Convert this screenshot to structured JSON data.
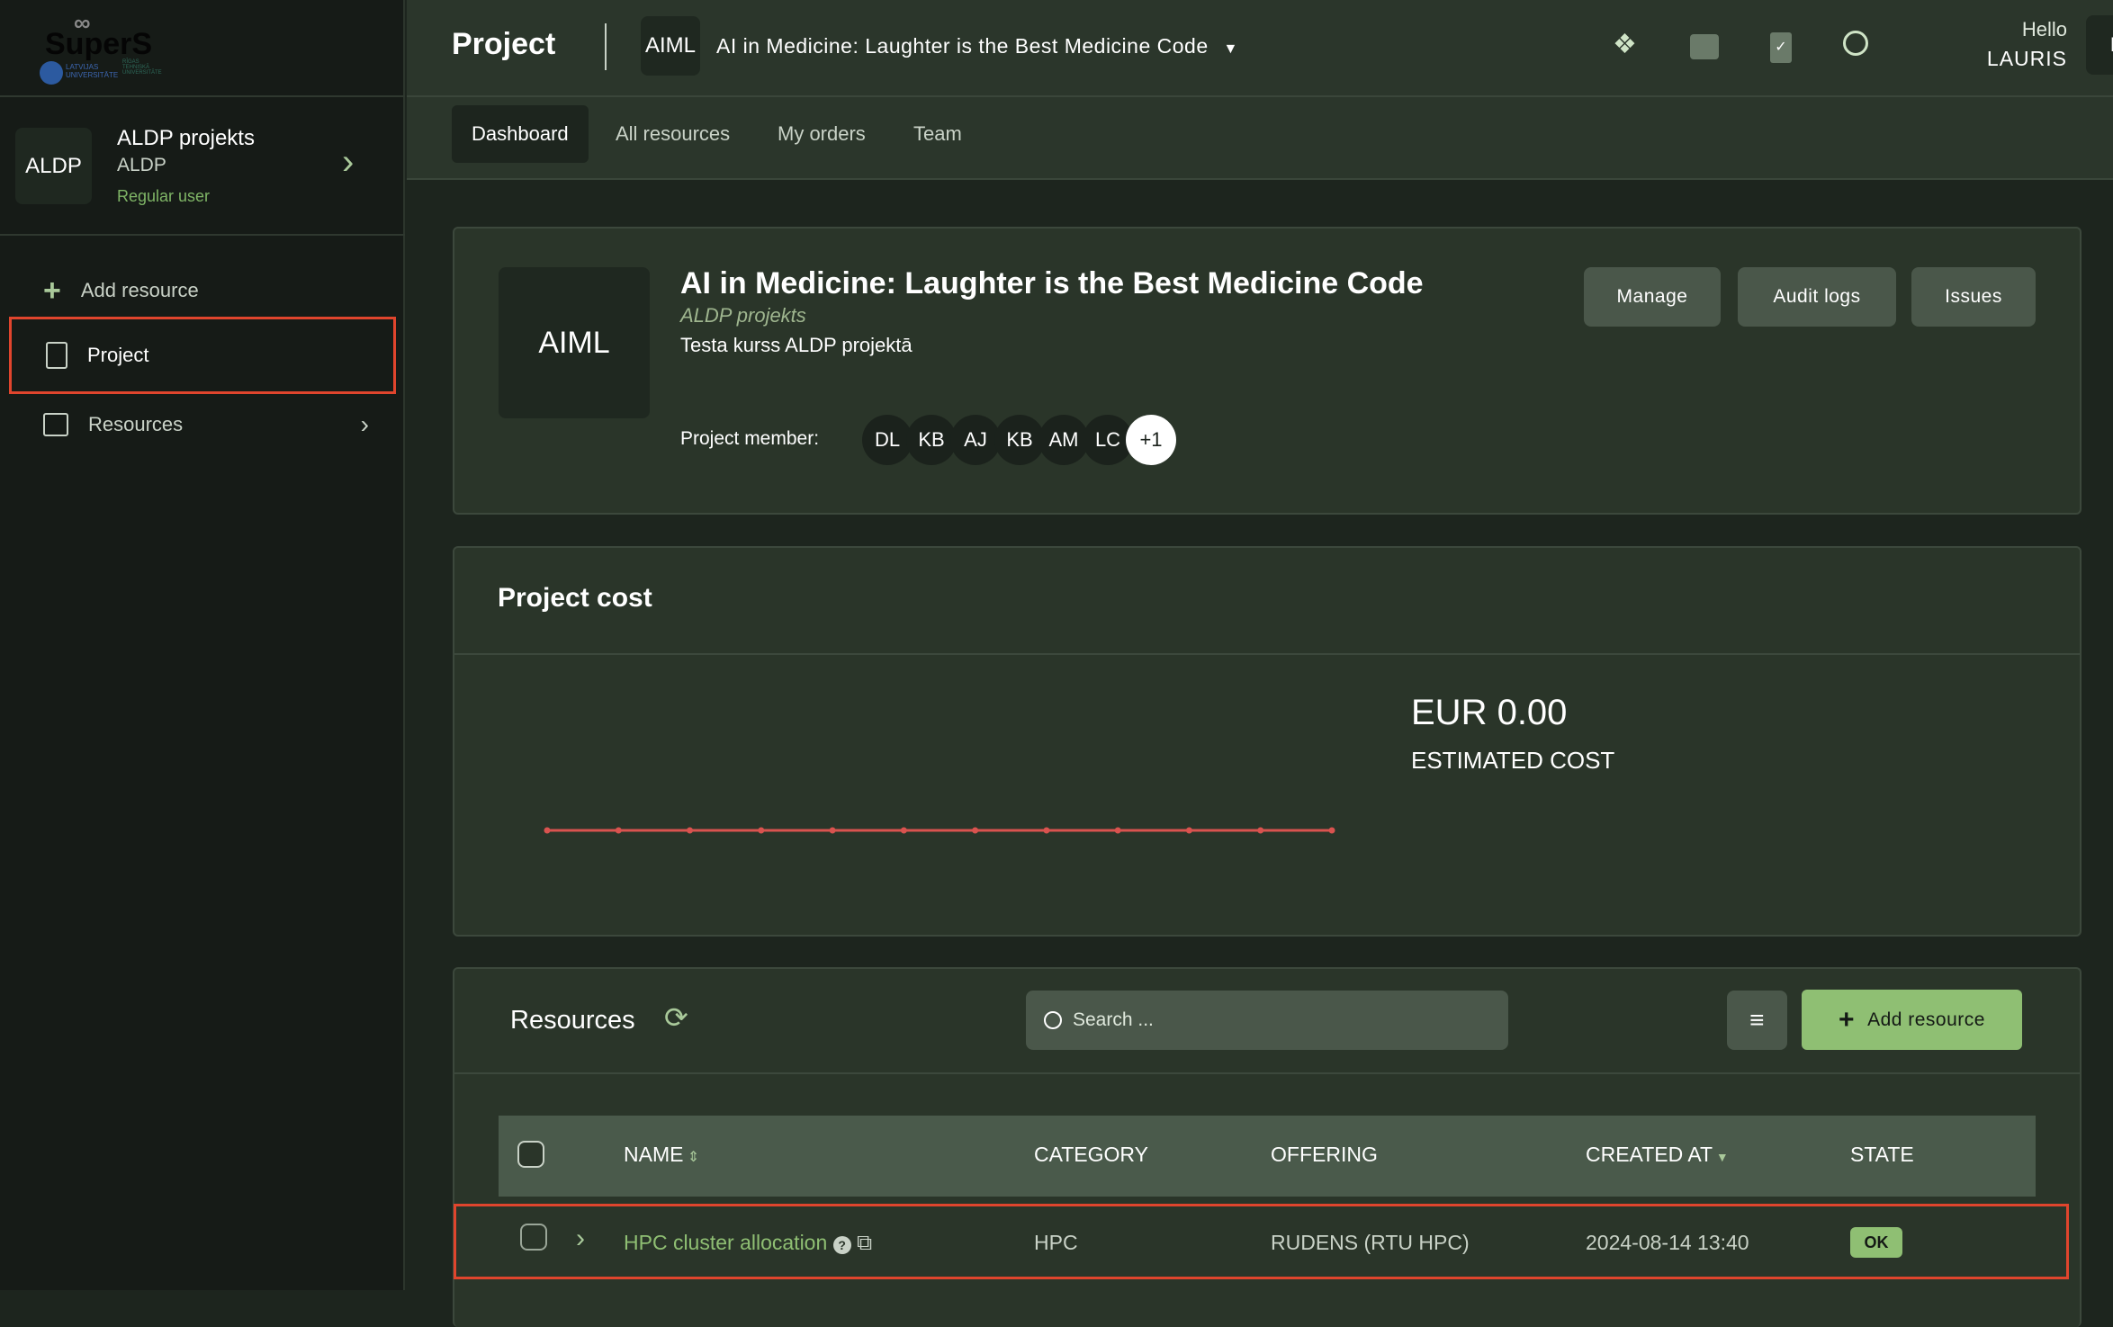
{
  "logo": {
    "text": "SuperS",
    "partners": [
      "LATVIJAS UNIVERSITĀTE",
      "RĪGAS TEHNISKĀ UNIVERSITĀTE"
    ]
  },
  "sidebar": {
    "org": {
      "abbr": "ALDP",
      "name": "ALDP projekts",
      "short": "ALDP",
      "role": "Regular user"
    },
    "items": [
      {
        "label": "Add resource",
        "icon": "plus-icon"
      },
      {
        "label": "Project",
        "icon": "clipboard-icon",
        "selected": true
      },
      {
        "label": "Resources",
        "icon": "drawer-icon"
      }
    ]
  },
  "header": {
    "title": "Project",
    "project_abbr": "AIML",
    "project_name": "AI in Medicine: Laughter is the Best Medicine Code",
    "greeting": "Hello",
    "user": "LAURIS",
    "avatar": "L"
  },
  "tabs": [
    {
      "label": "Dashboard",
      "active": true
    },
    {
      "label": "All resources"
    },
    {
      "label": "My orders"
    },
    {
      "label": "Team"
    }
  ],
  "project": {
    "abbr": "AIML",
    "title": "AI in Medicine: Laughter is the Best Medicine Code",
    "org": "ALDP projekts",
    "description": "Testa kurss ALDP projektā",
    "members_label": "Project member:",
    "members": [
      "DL",
      "KB",
      "AJ",
      "KB",
      "AM",
      "LC"
    ],
    "more_members": "+1",
    "buttons": [
      "Manage",
      "Audit logs",
      "Issues"
    ]
  },
  "cost": {
    "title": "Project cost",
    "amount": "EUR 0.00",
    "label": "ESTIMATED COST",
    "line_color": "#d9534f"
  },
  "chart_data": {
    "type": "line",
    "values": [
      0,
      0,
      0,
      0,
      0,
      0,
      0,
      0,
      0,
      0,
      0,
      0
    ],
    "grid": false
  },
  "resources": {
    "title": "Resources",
    "search_placeholder": "Search ...",
    "add_label": "Add resource",
    "columns": [
      "NAME",
      "CATEGORY",
      "OFFERING",
      "CREATED AT",
      "STATE"
    ],
    "rows": [
      {
        "name": "HPC cluster allocation",
        "category": "HPC",
        "offering": "RUDENS (RTU HPC)",
        "created": "2024-08-14 13:40",
        "state": "OK"
      }
    ]
  },
  "colors": {
    "accent": "#8fbf73",
    "highlight": "#e0452d"
  }
}
